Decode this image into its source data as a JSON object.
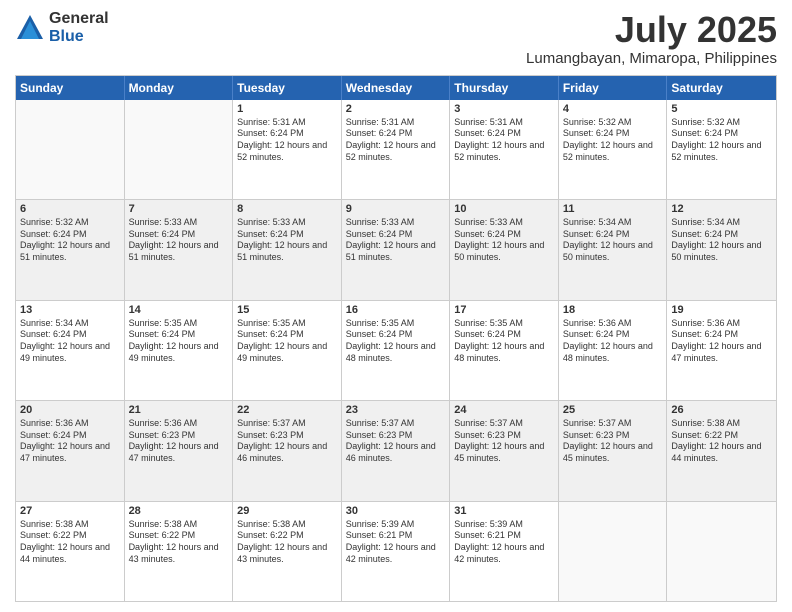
{
  "logo": {
    "general": "General",
    "blue": "Blue"
  },
  "title": "July 2025",
  "location": "Lumangbayan, Mimaropa, Philippines",
  "days": [
    "Sunday",
    "Monday",
    "Tuesday",
    "Wednesday",
    "Thursday",
    "Friday",
    "Saturday"
  ],
  "weeks": [
    [
      {
        "day": "",
        "sunrise": "",
        "sunset": "",
        "daylight": "",
        "empty": true
      },
      {
        "day": "",
        "sunrise": "",
        "sunset": "",
        "daylight": "",
        "empty": true
      },
      {
        "day": "1",
        "sunrise": "Sunrise: 5:31 AM",
        "sunset": "Sunset: 6:24 PM",
        "daylight": "Daylight: 12 hours and 52 minutes."
      },
      {
        "day": "2",
        "sunrise": "Sunrise: 5:31 AM",
        "sunset": "Sunset: 6:24 PM",
        "daylight": "Daylight: 12 hours and 52 minutes."
      },
      {
        "day": "3",
        "sunrise": "Sunrise: 5:31 AM",
        "sunset": "Sunset: 6:24 PM",
        "daylight": "Daylight: 12 hours and 52 minutes."
      },
      {
        "day": "4",
        "sunrise": "Sunrise: 5:32 AM",
        "sunset": "Sunset: 6:24 PM",
        "daylight": "Daylight: 12 hours and 52 minutes."
      },
      {
        "day": "5",
        "sunrise": "Sunrise: 5:32 AM",
        "sunset": "Sunset: 6:24 PM",
        "daylight": "Daylight: 12 hours and 52 minutes."
      }
    ],
    [
      {
        "day": "6",
        "sunrise": "Sunrise: 5:32 AM",
        "sunset": "Sunset: 6:24 PM",
        "daylight": "Daylight: 12 hours and 51 minutes.",
        "shaded": true
      },
      {
        "day": "7",
        "sunrise": "Sunrise: 5:33 AM",
        "sunset": "Sunset: 6:24 PM",
        "daylight": "Daylight: 12 hours and 51 minutes.",
        "shaded": true
      },
      {
        "day": "8",
        "sunrise": "Sunrise: 5:33 AM",
        "sunset": "Sunset: 6:24 PM",
        "daylight": "Daylight: 12 hours and 51 minutes.",
        "shaded": true
      },
      {
        "day": "9",
        "sunrise": "Sunrise: 5:33 AM",
        "sunset": "Sunset: 6:24 PM",
        "daylight": "Daylight: 12 hours and 51 minutes.",
        "shaded": true
      },
      {
        "day": "10",
        "sunrise": "Sunrise: 5:33 AM",
        "sunset": "Sunset: 6:24 PM",
        "daylight": "Daylight: 12 hours and 50 minutes.",
        "shaded": true
      },
      {
        "day": "11",
        "sunrise": "Sunrise: 5:34 AM",
        "sunset": "Sunset: 6:24 PM",
        "daylight": "Daylight: 12 hours and 50 minutes.",
        "shaded": true
      },
      {
        "day": "12",
        "sunrise": "Sunrise: 5:34 AM",
        "sunset": "Sunset: 6:24 PM",
        "daylight": "Daylight: 12 hours and 50 minutes.",
        "shaded": true
      }
    ],
    [
      {
        "day": "13",
        "sunrise": "Sunrise: 5:34 AM",
        "sunset": "Sunset: 6:24 PM",
        "daylight": "Daylight: 12 hours and 49 minutes."
      },
      {
        "day": "14",
        "sunrise": "Sunrise: 5:35 AM",
        "sunset": "Sunset: 6:24 PM",
        "daylight": "Daylight: 12 hours and 49 minutes."
      },
      {
        "day": "15",
        "sunrise": "Sunrise: 5:35 AM",
        "sunset": "Sunset: 6:24 PM",
        "daylight": "Daylight: 12 hours and 49 minutes."
      },
      {
        "day": "16",
        "sunrise": "Sunrise: 5:35 AM",
        "sunset": "Sunset: 6:24 PM",
        "daylight": "Daylight: 12 hours and 48 minutes."
      },
      {
        "day": "17",
        "sunrise": "Sunrise: 5:35 AM",
        "sunset": "Sunset: 6:24 PM",
        "daylight": "Daylight: 12 hours and 48 minutes."
      },
      {
        "day": "18",
        "sunrise": "Sunrise: 5:36 AM",
        "sunset": "Sunset: 6:24 PM",
        "daylight": "Daylight: 12 hours and 48 minutes."
      },
      {
        "day": "19",
        "sunrise": "Sunrise: 5:36 AM",
        "sunset": "Sunset: 6:24 PM",
        "daylight": "Daylight: 12 hours and 47 minutes."
      }
    ],
    [
      {
        "day": "20",
        "sunrise": "Sunrise: 5:36 AM",
        "sunset": "Sunset: 6:24 PM",
        "daylight": "Daylight: 12 hours and 47 minutes.",
        "shaded": true
      },
      {
        "day": "21",
        "sunrise": "Sunrise: 5:36 AM",
        "sunset": "Sunset: 6:23 PM",
        "daylight": "Daylight: 12 hours and 47 minutes.",
        "shaded": true
      },
      {
        "day": "22",
        "sunrise": "Sunrise: 5:37 AM",
        "sunset": "Sunset: 6:23 PM",
        "daylight": "Daylight: 12 hours and 46 minutes.",
        "shaded": true
      },
      {
        "day": "23",
        "sunrise": "Sunrise: 5:37 AM",
        "sunset": "Sunset: 6:23 PM",
        "daylight": "Daylight: 12 hours and 46 minutes.",
        "shaded": true
      },
      {
        "day": "24",
        "sunrise": "Sunrise: 5:37 AM",
        "sunset": "Sunset: 6:23 PM",
        "daylight": "Daylight: 12 hours and 45 minutes.",
        "shaded": true
      },
      {
        "day": "25",
        "sunrise": "Sunrise: 5:37 AM",
        "sunset": "Sunset: 6:23 PM",
        "daylight": "Daylight: 12 hours and 45 minutes.",
        "shaded": true
      },
      {
        "day": "26",
        "sunrise": "Sunrise: 5:38 AM",
        "sunset": "Sunset: 6:22 PM",
        "daylight": "Daylight: 12 hours and 44 minutes.",
        "shaded": true
      }
    ],
    [
      {
        "day": "27",
        "sunrise": "Sunrise: 5:38 AM",
        "sunset": "Sunset: 6:22 PM",
        "daylight": "Daylight: 12 hours and 44 minutes."
      },
      {
        "day": "28",
        "sunrise": "Sunrise: 5:38 AM",
        "sunset": "Sunset: 6:22 PM",
        "daylight": "Daylight: 12 hours and 43 minutes."
      },
      {
        "day": "29",
        "sunrise": "Sunrise: 5:38 AM",
        "sunset": "Sunset: 6:22 PM",
        "daylight": "Daylight: 12 hours and 43 minutes."
      },
      {
        "day": "30",
        "sunrise": "Sunrise: 5:39 AM",
        "sunset": "Sunset: 6:21 PM",
        "daylight": "Daylight: 12 hours and 42 minutes."
      },
      {
        "day": "31",
        "sunrise": "Sunrise: 5:39 AM",
        "sunset": "Sunset: 6:21 PM",
        "daylight": "Daylight: 12 hours and 42 minutes."
      },
      {
        "day": "",
        "sunrise": "",
        "sunset": "",
        "daylight": "",
        "empty": true
      },
      {
        "day": "",
        "sunrise": "",
        "sunset": "",
        "daylight": "",
        "empty": true
      }
    ]
  ]
}
